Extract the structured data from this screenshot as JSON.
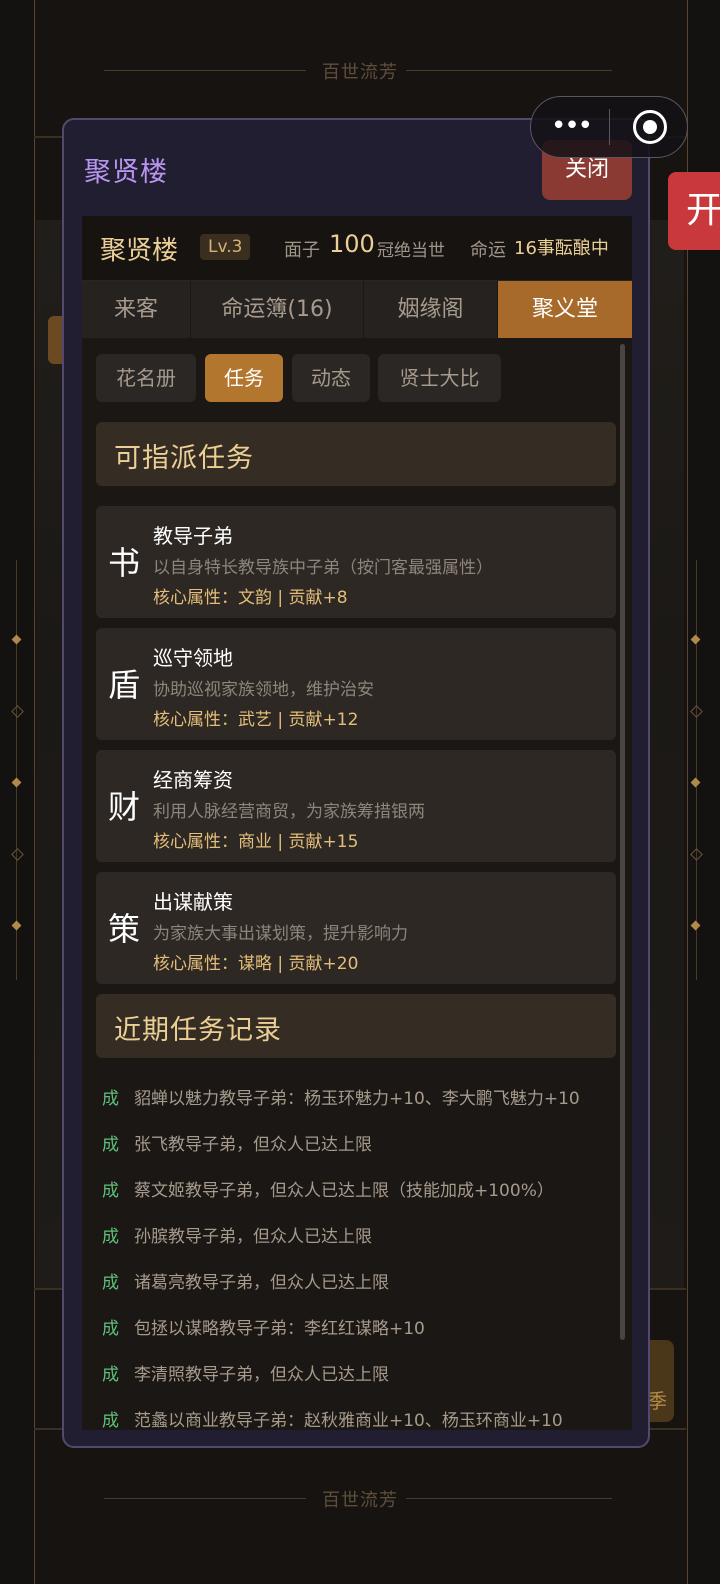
{
  "background": {
    "top_title": "百世流芳",
    "bottom_title": "百世流芳",
    "side_tab_glyph": "开",
    "season_glyph": "季"
  },
  "capsule": {
    "more_icon": "more-dots",
    "close_icon": "target-circle"
  },
  "modal": {
    "title": "聚贤楼",
    "close_label": "关闭",
    "header": {
      "name": "聚贤楼",
      "level": "Lv.3",
      "face_label": "面子",
      "face_value": "100",
      "face_title": "冠绝当世",
      "fate_label": "命运",
      "fate_value": "16事酝酿中"
    },
    "tabs": [
      {
        "label": "来客",
        "active": false
      },
      {
        "label": "命运簿(16)",
        "active": false
      },
      {
        "label": "姻缘阁",
        "active": false
      },
      {
        "label": "聚义堂",
        "active": true
      }
    ],
    "subtabs": [
      {
        "label": "花名册",
        "active": false
      },
      {
        "label": "任务",
        "active": true
      },
      {
        "label": "动态",
        "active": false
      },
      {
        "label": "贤士大比",
        "active": false
      }
    ],
    "assignable_heading": "可指派任务",
    "tasks": [
      {
        "glyph": "书",
        "name": "教导子弟",
        "desc": "以自身特长教导族中子弟（按门客最强属性）",
        "attr": "核心属性：文韵 | 贡献+8"
      },
      {
        "glyph": "盾",
        "name": "巡守领地",
        "desc": "协助巡视家族领地，维护治安",
        "attr": "核心属性：武艺 | 贡献+12"
      },
      {
        "glyph": "财",
        "name": "经商筹资",
        "desc": "利用人脉经营商贸，为家族筹措银两",
        "attr": "核心属性：商业 | 贡献+15"
      },
      {
        "glyph": "策",
        "name": "出谋献策",
        "desc": "为家族大事出谋划策，提升影响力",
        "attr": "核心属性：谋略 | 贡献+20"
      }
    ],
    "records_heading": "近期任务记录",
    "records": [
      {
        "tag": "成",
        "text": "貂蝉以魅力教导子弟：杨玉环魅力+10、李大鹏飞魅力+10"
      },
      {
        "tag": "成",
        "text": "张飞教导子弟，但众人已达上限"
      },
      {
        "tag": "成",
        "text": "蔡文姬教导子弟，但众人已达上限（技能加成+100%）"
      },
      {
        "tag": "成",
        "text": "孙膑教导子弟，但众人已达上限"
      },
      {
        "tag": "成",
        "text": "诸葛亮教导子弟，但众人已达上限"
      },
      {
        "tag": "成",
        "text": "包拯以谋略教导子弟：李红红谋略+10"
      },
      {
        "tag": "成",
        "text": "李清照教导子弟，但众人已达上限"
      },
      {
        "tag": "成",
        "text": "范蠡以商业教导子弟：赵秋雅商业+10、杨玉环商业+10"
      }
    ]
  },
  "colors": {
    "accent_gold": "#eccf95",
    "active_tab": "#a76a2b",
    "success_tag": "#5ec07a",
    "modal_title": "#b896f0",
    "close_button": "#8a3a32"
  }
}
